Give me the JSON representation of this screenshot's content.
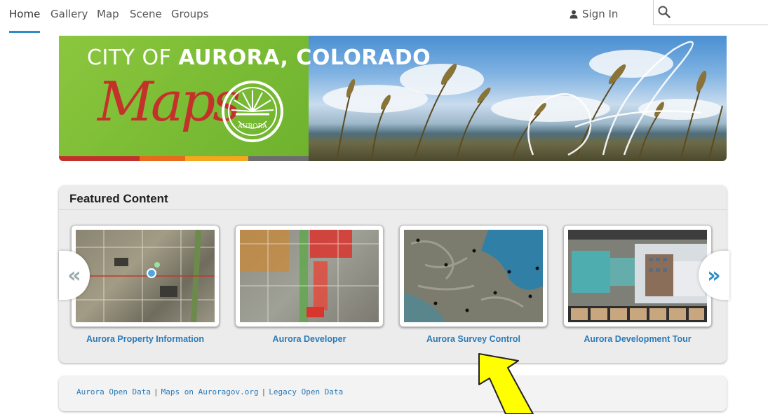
{
  "nav": {
    "items": [
      "Home",
      "Gallery",
      "Map",
      "Scene",
      "Groups"
    ],
    "active": "Home",
    "sign_in": "Sign In",
    "search_placeholder": "",
    "accent_color": "#2d8cc7"
  },
  "banner": {
    "line1_prefix": "CITY OF ",
    "line1_bold": "AURORA,",
    "line1_suffix": " COLORADO",
    "maps_word": "Maps",
    "seal_text": "AURORA",
    "brand_green": "#8cc63f",
    "brand_red": "#c4312b"
  },
  "featured": {
    "title": "Featured Content",
    "items": [
      {
        "title": "Aurora Property Information",
        "thumb": "aerial-map-parcels"
      },
      {
        "title": "Aurora Developer",
        "thumb": "aerial-map-zoning"
      },
      {
        "title": "Aurora Survey Control",
        "thumb": "aerial-map-survey-points"
      },
      {
        "title": "Aurora Development Tour",
        "thumb": "development-tour-app"
      }
    ],
    "prev_icon": "double-chevron-left-icon",
    "next_icon": "double-chevron-right-icon",
    "link_color": "#2c7bb6"
  },
  "footer": {
    "links": [
      "Aurora Open Data",
      "Maps on Auroragov.org",
      "Legacy Open Data"
    ],
    "separator": "|"
  },
  "annotation": {
    "icon": "yellow-pointer-arrow-icon",
    "color": "#ffff00"
  }
}
